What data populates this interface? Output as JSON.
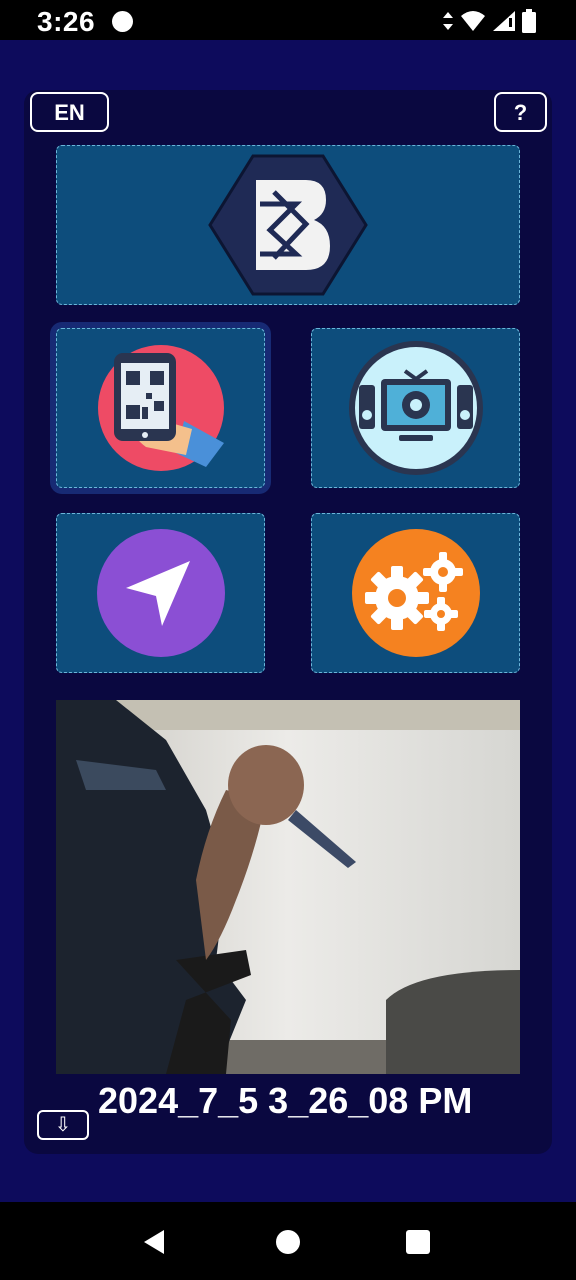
{
  "status_bar": {
    "time": "3:26",
    "icons": [
      "notification-dot-icon",
      "data-arrows-icon",
      "wifi-icon",
      "signal-icon",
      "battery-icon"
    ]
  },
  "toolbar": {
    "language_label": "EN",
    "help_label": "?"
  },
  "tiles": {
    "logo": {
      "icon": "brand-logo-b-icon"
    },
    "qr_scan": {
      "icon": "qr-code-phone-icon",
      "color": "#ee4b65"
    },
    "media": {
      "icon": "tv-speaker-icon",
      "color": "#c9f1fb"
    },
    "location": {
      "icon": "navigation-arrow-icon",
      "color": "#8b4fd4"
    },
    "settings": {
      "icon": "gears-icon",
      "color": "#f58220"
    }
  },
  "camera": {
    "timestamp": "2024_7_5 3_26_08 PM",
    "download_label": "⇩"
  },
  "colors": {
    "background": "#0d0b5c",
    "panel": "#0a0840",
    "tile": "#0d4d7c",
    "tile_border": "#6bb6da"
  }
}
